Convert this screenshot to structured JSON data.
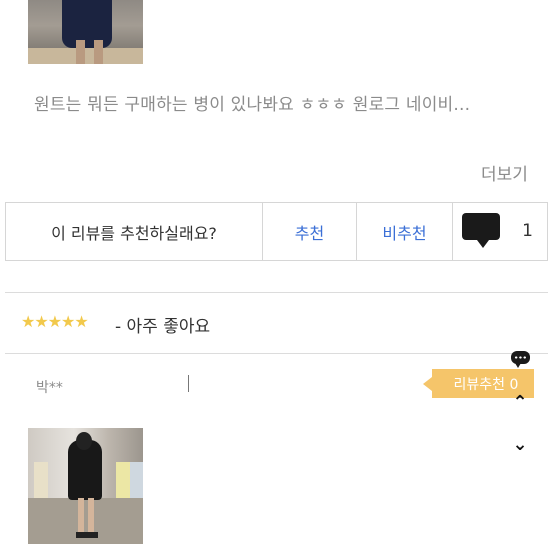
{
  "review": {
    "text": "원트는 뭐든 구매하는 병이 있나봐요 ㅎㅎㅎ 원로그 네이비...",
    "more_label": "더보기"
  },
  "recommend_bar": {
    "question": "이 리뷰를 추천하실래요?",
    "yes_label": "추천",
    "no_label": "비추천",
    "comment_count": "1"
  },
  "next_review": {
    "stars": "★★★★★",
    "rating_text": "- 아주 좋아요",
    "author": "박**",
    "recommend_tip": "리뷰추천 0"
  },
  "colors": {
    "accent": "#3b6fd6",
    "star": "#f2c94c",
    "tip": "#f5c56a"
  },
  "icons": {
    "chat": "chat-bubble-icon",
    "up": "chevron-up-icon",
    "down": "chevron-down-icon"
  }
}
